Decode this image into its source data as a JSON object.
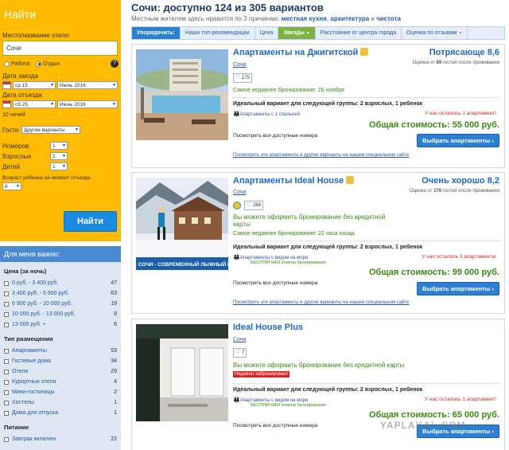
{
  "search": {
    "title": "Найти",
    "dest_label": "Место/название отеля:",
    "dest_value": "Сочи",
    "purpose_work": "Работа",
    "purpose_leisure": "Отдых",
    "help": "?",
    "checkin_label": "Дата заезда",
    "checkin_day": "ср 15",
    "checkin_month": "Июнь 2016",
    "checkout_label": "Дата отъезда",
    "checkout_day": "сб 25",
    "checkout_month": "Июнь 2016",
    "nights": "10 ночей",
    "guests_label": "Гости",
    "guests_value": "Другие варианты",
    "rooms_label": "Номеров",
    "rooms_value": "1",
    "adults_label": "Взрослых",
    "adults_value": "2",
    "children_label": "Детей",
    "children_value": "1",
    "child_age_label": "Возраст ребенка на момент отъезда",
    "child_age_value": "6",
    "submit": "Найти"
  },
  "filters": {
    "header": "Для меня важно:",
    "groups": [
      {
        "title": "Цена (за ночь)",
        "items": [
          {
            "label": "0 руб. - 3 400 руб.",
            "count": "47"
          },
          {
            "label": "3 400 руб. - 6 900 руб.",
            "count": "63"
          },
          {
            "label": "6 900 руб. - 10 000 руб.",
            "count": "19"
          },
          {
            "label": "10 000 руб. - 13 000 руб.",
            "count": "8"
          },
          {
            "label": "13 000 руб. +",
            "count": "6"
          }
        ]
      },
      {
        "title": "Тип размещения",
        "items": [
          {
            "label": "Апартаменты",
            "count": "53"
          },
          {
            "label": "Гостевые дома",
            "count": "34"
          },
          {
            "label": "Отели",
            "count": "29"
          },
          {
            "label": "Курортные отели",
            "count": "4"
          },
          {
            "label": "Мини-гостиницы",
            "count": "2"
          },
          {
            "label": "Хостелы",
            "count": "1"
          },
          {
            "label": "Дома для отпуска",
            "count": "1"
          }
        ]
      },
      {
        "title": "Питание",
        "items": [
          {
            "label": "Завтрак включен",
            "count": "22"
          }
        ]
      }
    ]
  },
  "main": {
    "title": "Сочи: доступно 124 из 305 вариантов",
    "subtitle_prefix": "Местным жителям здесь нравится по 3 причинам:",
    "reason1": "местная кухня",
    "reason2": "архитектура",
    "reason3": "чистота",
    "sep1": ",",
    "sep2": "и",
    "sort": {
      "lead": "Упорядочить:",
      "top": "Наши топ-рекомендации",
      "price": "Цена",
      "stars": "Звезды",
      "distance": "Расстояние от центра города",
      "reviews": "Оценка по отзывам"
    }
  },
  "hotels": [
    {
      "name": "Апартаменты на Джигитской",
      "city": "Сочи",
      "likes": "175",
      "rating": "Потрясающе 8,6",
      "rating_sub_prefix": "Оценка от",
      "rating_count": "89",
      "rating_sub_suffix": "гостей после проживания",
      "recent": "Самое недавнее бронирование: 28 ноября",
      "ideal": "Идеальный вариант для следующей группы: 2 взрослых, 1 ребенок",
      "room": "Апартаменты с 1 спальней",
      "left": "У нас осталось 1 апартамент!",
      "total": "Общая стоимость: 55 000 руб.",
      "choose": "Выбрать апартаменты",
      "see_all": "Посмотреть все доступные номера",
      "special": "Посмотреть эти апартаменты и другие варианты на нашем специальном сайте"
    },
    {
      "name": "Апартаменты Ideal House",
      "city": "Сочи",
      "likes": "288",
      "rating": "Очень хорошо 8,2",
      "rating_sub_prefix": "Оценка от",
      "rating_count": "176",
      "rating_sub_suffix": "гостей после проживания",
      "no_card": "Вы можете оформить бронирование без кредитной карты",
      "recent": "Самое недавнее бронирование: 22 часа назад",
      "ideal": "Идеальный вариант для следующей группы: 2 взрослых, 1 ребенок",
      "room": "Апартаменты с видом на море",
      "free_cancel": "БЕСПЛАТНАЯ отмена бронирования",
      "left": "У нас осталось 3 апартамента!",
      "total": "Общая стоимость: 99 000 руб.",
      "choose": "Выбрать апартаменты",
      "see_all": "Посмотреть все доступные номера",
      "special": "Посмотреть эти апартаменты и другие варианты на нашем специальном сайте",
      "photo_caption": "СОЧИ - СОВРЕМЕННЫЙ ЛЫЖНЫЙ КУРОРТ"
    },
    {
      "name": "Ideal House Plus",
      "city": "Сочи",
      "likes": "7",
      "badge": "Недавно забронирован!",
      "no_card": "Вы можете оформить бронирование без кредитной карты",
      "ideal": "Идеальный вариант для следующей группы: 2 взрослых, 1 ребенок",
      "room": "Апартаменты с видом на море",
      "free_cancel": "БЕСПЛАТНАЯ отмена бронирования",
      "left": "У нас осталось 1 апартамент!",
      "total": "Общая стоимость: 65 000 руб.",
      "choose": "Выбрать апартаменты",
      "see_all": "Посмотреть все доступные номера"
    }
  ],
  "watermark": "YAPLAKAL.COM"
}
